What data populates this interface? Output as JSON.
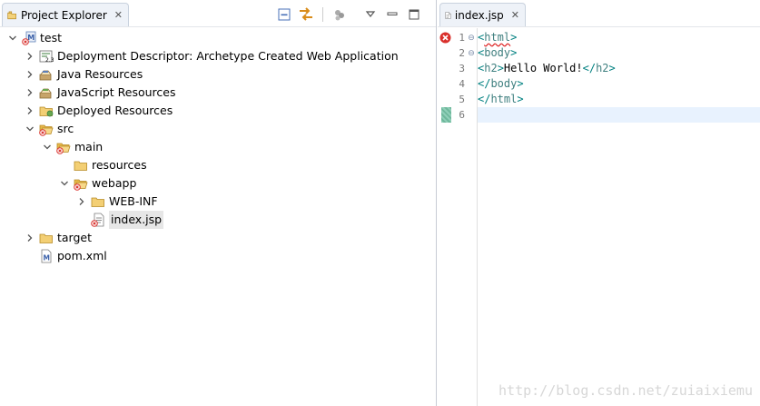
{
  "project_explorer": {
    "tab_label": "Project Explorer",
    "tab_close": "✕",
    "toolbar_icons": [
      "collapse-all-icon",
      "link-with-editor-icon",
      "filters-icon",
      "view-menu-icon",
      "minimize-icon",
      "maximize-icon"
    ],
    "tree": [
      {
        "label": "test",
        "level": 0,
        "twisty": "expanded",
        "icon": "maven-project-error-icon"
      },
      {
        "label": "Deployment Descriptor: Archetype Created Web Application",
        "level": 1,
        "twisty": "collapsed",
        "icon": "deployment-descriptor-icon"
      },
      {
        "label": "Java Resources",
        "level": 1,
        "twisty": "collapsed",
        "icon": "java-resources-icon"
      },
      {
        "label": "JavaScript Resources",
        "level": 1,
        "twisty": "collapsed",
        "icon": "javascript-resources-icon"
      },
      {
        "label": "Deployed Resources",
        "level": 1,
        "twisty": "collapsed",
        "icon": "deployed-resources-icon"
      },
      {
        "label": "src",
        "level": 1,
        "twisty": "expanded",
        "icon": "folder-error-icon"
      },
      {
        "label": "main",
        "level": 2,
        "twisty": "expanded",
        "icon": "folder-error-icon"
      },
      {
        "label": "resources",
        "level": 3,
        "twisty": "none",
        "icon": "folder-icon"
      },
      {
        "label": "webapp",
        "level": 3,
        "twisty": "expanded",
        "icon": "folder-error-icon"
      },
      {
        "label": "WEB-INF",
        "level": 4,
        "twisty": "collapsed",
        "icon": "folder-icon"
      },
      {
        "label": "index.jsp",
        "level": 4,
        "twisty": "none",
        "icon": "jsp-file-error-icon",
        "selected": true
      },
      {
        "label": "target",
        "level": 1,
        "twisty": "collapsed",
        "icon": "folder-icon"
      },
      {
        "label": "pom.xml",
        "level": 1,
        "twisty": "none",
        "icon": "pom-file-icon"
      }
    ]
  },
  "editor": {
    "tab_label": "index.jsp",
    "tab_close": "✕",
    "lines": [
      {
        "num": "1",
        "fold": "⊖",
        "marker": "error",
        "parts": [
          {
            "t": "<",
            "c": "bracket"
          },
          {
            "t": "html",
            "c": "tag squig"
          },
          {
            "t": ">",
            "c": "bracket"
          }
        ]
      },
      {
        "num": "2",
        "fold": "⊖",
        "marker": "",
        "parts": [
          {
            "t": "<",
            "c": "bracket"
          },
          {
            "t": "body",
            "c": "tag"
          },
          {
            "t": ">",
            "c": "bracket"
          }
        ]
      },
      {
        "num": "3",
        "fold": "",
        "marker": "",
        "parts": [
          {
            "t": "<",
            "c": "bracket"
          },
          {
            "t": "h2",
            "c": "tag"
          },
          {
            "t": ">",
            "c": "bracket"
          },
          {
            "t": "Hello World!",
            "c": "txt"
          },
          {
            "t": "</",
            "c": "bracket"
          },
          {
            "t": "h2",
            "c": "tag"
          },
          {
            "t": ">",
            "c": "bracket"
          }
        ]
      },
      {
        "num": "4",
        "fold": "",
        "marker": "",
        "parts": [
          {
            "t": "</",
            "c": "bracket"
          },
          {
            "t": "body",
            "c": "tag"
          },
          {
            "t": ">",
            "c": "bracket"
          }
        ]
      },
      {
        "num": "5",
        "fold": "",
        "marker": "",
        "parts": [
          {
            "t": "</",
            "c": "bracket"
          },
          {
            "t": "html",
            "c": "tag"
          },
          {
            "t": ">",
            "c": "bracket"
          }
        ]
      },
      {
        "num": "6",
        "fold": "",
        "marker": "current",
        "parts": []
      }
    ],
    "watermark": "http://blog.csdn.net/zuiaixiemu"
  },
  "colors": {
    "error": "#d9302c",
    "folder": "#e8b84a",
    "tag": "#3f7f7f",
    "current_line": "#e8f2fe"
  }
}
